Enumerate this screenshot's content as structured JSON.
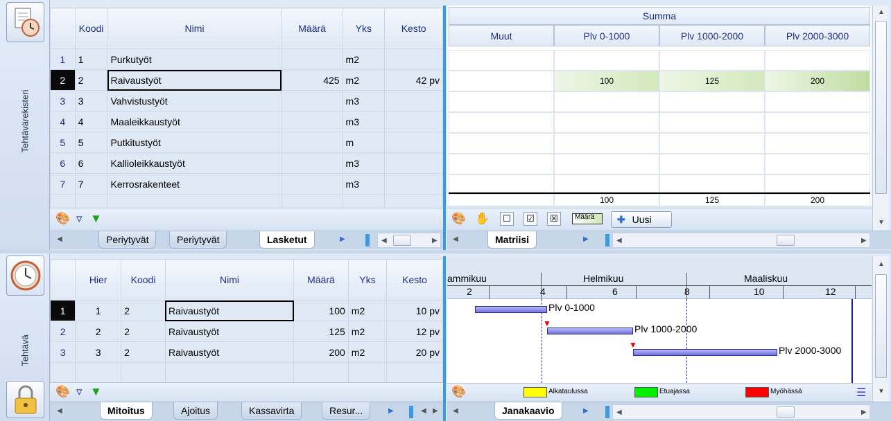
{
  "top": {
    "sidebar_label": "Tehtävärekisteri",
    "columns": [
      "Koodi",
      "Nimi",
      "Määrä",
      "Yks",
      "Kesto"
    ],
    "rows": [
      {
        "n": "1",
        "koodi": "1",
        "nimi": "Purkutyöt",
        "maara": "",
        "yks": "m2",
        "kesto": ""
      },
      {
        "n": "2",
        "koodi": "2",
        "nimi": "Raivaustyöt",
        "maara": "425",
        "yks": "m2",
        "kesto": "42 pv"
      },
      {
        "n": "3",
        "koodi": "3",
        "nimi": "Vahvistustyöt",
        "maara": "",
        "yks": "m3",
        "kesto": ""
      },
      {
        "n": "4",
        "koodi": "4",
        "nimi": "Maaleikkaustyöt",
        "maara": "",
        "yks": "m3",
        "kesto": ""
      },
      {
        "n": "5",
        "koodi": "5",
        "nimi": "Putkitustyöt",
        "maara": "",
        "yks": "m",
        "kesto": ""
      },
      {
        "n": "6",
        "koodi": "6",
        "nimi": "Kallioleikkaustyöt",
        "maara": "",
        "yks": "m3",
        "kesto": ""
      },
      {
        "n": "7",
        "koodi": "7",
        "nimi": "Kerrosrakenteet",
        "maara": "",
        "yks": "m3",
        "kesto": ""
      }
    ],
    "tabs": [
      "Periytyvät",
      "Periytyvät",
      "Lasketut"
    ],
    "matrix": {
      "title": "Summa",
      "columns": [
        "Muut",
        "Plv 0-1000",
        "Plv 1000-2000",
        "Plv 2000-3000"
      ],
      "row2_values": [
        "",
        "100",
        "125",
        "200"
      ],
      "totals": [
        "",
        "100",
        "125",
        "200"
      ],
      "legend_label": "Määrä",
      "new_button": "Uusi",
      "tab": "Matriisi"
    }
  },
  "bottom": {
    "sidebar_label": "Tehtävä",
    "columns": [
      "Hier",
      "Koodi",
      "Nimi",
      "Määrä",
      "Yks",
      "Kesto"
    ],
    "rows": [
      {
        "n": "1",
        "hier": "1",
        "koodi": "2",
        "nimi": "Raivaustyöt",
        "maara": "100",
        "yks": "m2",
        "kesto": "10 pv"
      },
      {
        "n": "2",
        "hier": "2",
        "koodi": "2",
        "nimi": "Raivaustyöt",
        "maara": "125",
        "yks": "m2",
        "kesto": "12 pv"
      },
      {
        "n": "3",
        "hier": "3",
        "koodi": "2",
        "nimi": "Raivaustyöt",
        "maara": "200",
        "yks": "m2",
        "kesto": "20 pv"
      }
    ],
    "tabs": [
      "Mitoitus",
      "Ajoitus",
      "Kassavirta",
      "Resur..."
    ],
    "gantt": {
      "months": [
        "ammikuu",
        "Helmikuu",
        "Maaliskuu"
      ],
      "weeks": [
        "2",
        "4",
        "6",
        "8",
        "10",
        "12"
      ],
      "bars": [
        {
          "label": "Plv 0-1000"
        },
        {
          "label": "Plv 1000-2000"
        },
        {
          "label": "Plv 2000-3000"
        }
      ],
      "legend": [
        {
          "label": "Alkataulussa",
          "color": "#ffff00"
        },
        {
          "label": "Etuajassa",
          "color": "#00ee00"
        },
        {
          "label": "Myöhässä",
          "color": "#ff0000"
        }
      ],
      "tab": "Janakaavio"
    }
  },
  "colors": {
    "accent": "#3a9be0",
    "header_text": "#1e2f86",
    "cell_green": "#d8ebc4"
  }
}
